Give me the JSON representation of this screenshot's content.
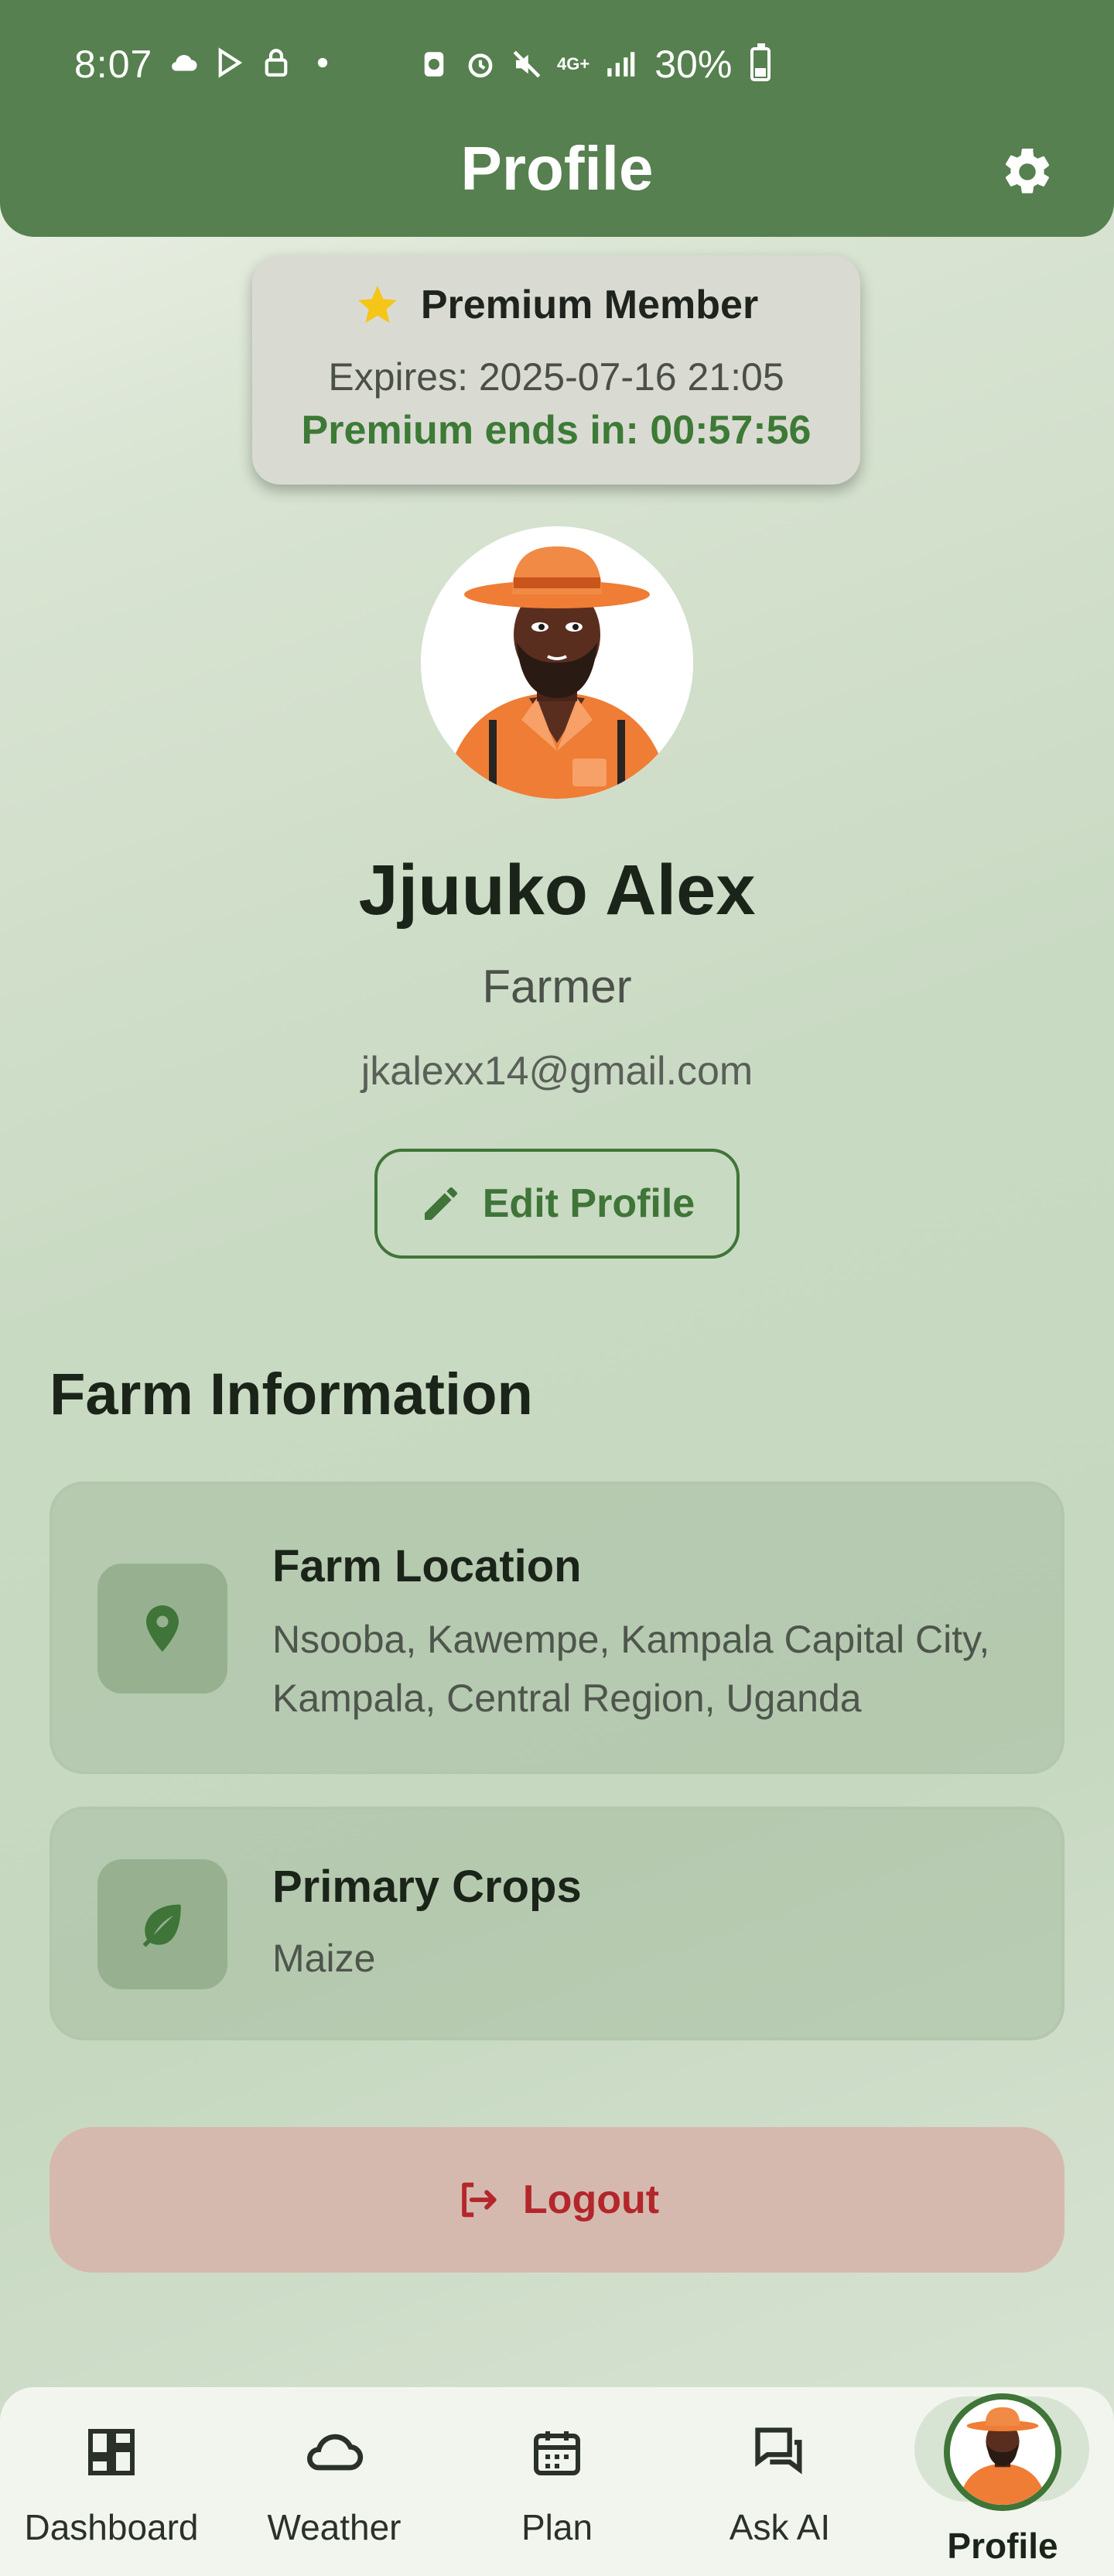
{
  "status_bar": {
    "time": "8:07",
    "network": "4G+",
    "battery": "30%"
  },
  "header": {
    "title": "Profile",
    "settings_icon": "gear-icon"
  },
  "premium": {
    "title": "Premium Member",
    "expiry": "Expires: 2025-07-16 21:05",
    "countdown": "Premium ends in: 00:57:56",
    "star_color": "#f5c518"
  },
  "user": {
    "name": "Jjuuko Alex",
    "role": "Farmer",
    "email": "jkalexx14@gmail.com",
    "edit_label": "Edit Profile"
  },
  "farm": {
    "section_title": "Farm Information",
    "location_title": "Farm Location",
    "location_value": "Nsooba, Kawempe, Kampala Capital City, Kampala, Central Region, Uganda",
    "crops_title": "Primary Crops",
    "crops_value": "Maize"
  },
  "logout": {
    "label": "Logout"
  },
  "nav": {
    "items": [
      {
        "label": "Dashboard",
        "icon": "dashboard-icon"
      },
      {
        "label": "Weather",
        "icon": "cloud-icon"
      },
      {
        "label": "Plan",
        "icon": "calendar-icon"
      },
      {
        "label": "Ask AI",
        "icon": "chat-icon"
      },
      {
        "label": "Profile",
        "icon": "avatar"
      }
    ],
    "active": "Profile"
  },
  "colors": {
    "primary": "#56804f",
    "accent": "#3f7538",
    "danger": "#b3262b"
  }
}
